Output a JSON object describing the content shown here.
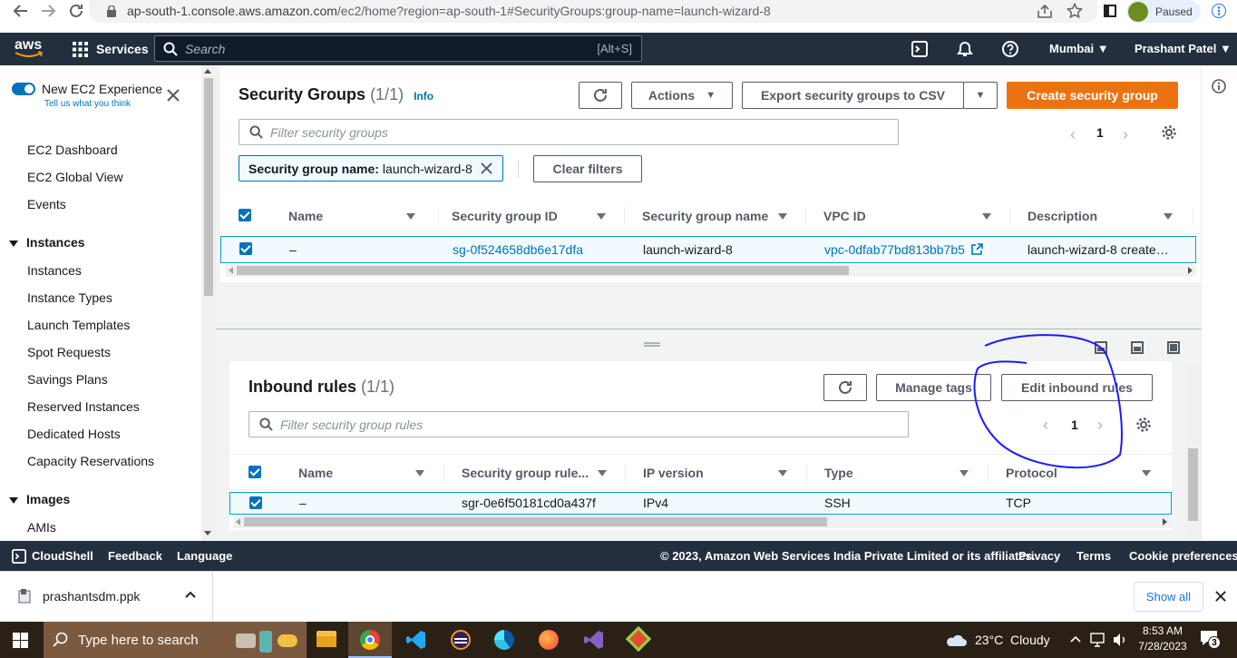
{
  "browser": {
    "url_host": "ap-south-1.console.aws.amazon.com",
    "url_path": "/ec2/home?region=ap-south-1#SecurityGroups:group-name=launch-wizard-8",
    "profile_status": "Paused"
  },
  "aws_nav": {
    "logo": "aws",
    "services_label": "Services",
    "search_placeholder": "Search",
    "search_shortcut": "[Alt+S]",
    "region": "Mumbai",
    "user": "Prashant Patel"
  },
  "sidebar": {
    "new_experience_label": "New EC2 Experience",
    "new_experience_sub": "Tell us what you think",
    "items_top": [
      "EC2 Dashboard",
      "EC2 Global View",
      "Events"
    ],
    "section_instances": "Instances",
    "instances_items": [
      "Instances",
      "Instance Types",
      "Launch Templates",
      "Spot Requests",
      "Savings Plans",
      "Reserved Instances",
      "Dedicated Hosts",
      "Capacity Reservations"
    ],
    "section_images": "Images",
    "images_items": [
      "AMIs"
    ]
  },
  "security_groups": {
    "title": "Security Groups",
    "count": "(1/1)",
    "info": "Info",
    "actions_label": "Actions",
    "export_label": "Export security groups to CSV",
    "create_label": "Create security group",
    "filter_placeholder": "Filter security groups",
    "page": "1",
    "token_key": "Security group name:",
    "token_value": "launch-wizard-8",
    "clear_filters": "Clear filters",
    "columns": [
      "Name",
      "Security group ID",
      "Security group name",
      "VPC ID",
      "Description"
    ],
    "row": {
      "name": "–",
      "sg_id": "sg-0f524658db6e17dfa",
      "sg_name": "launch-wizard-8",
      "vpc_id": "vpc-0dfab77bd813bb7b5",
      "description": "launch-wizard-8 create…"
    }
  },
  "inbound_rules": {
    "title": "Inbound rules",
    "count": "(1/1)",
    "manage_tags": "Manage tags",
    "edit_rules": "Edit inbound rules",
    "filter_placeholder": "Filter security group rules",
    "page": "1",
    "columns": [
      "Name",
      "Security group rule...",
      "IP version",
      "Type",
      "Protocol"
    ],
    "row": {
      "name": "–",
      "rule_id": "sgr-0e6f50181cd0a437f",
      "ip_version": "IPv4",
      "type": "SSH",
      "protocol": "TCP"
    }
  },
  "footer": {
    "cloudshell": "CloudShell",
    "feedback": "Feedback",
    "language": "Language",
    "copyright": "© 2023, Amazon Web Services India Private Limited or its affiliates.",
    "privacy": "Privacy",
    "terms": "Terms",
    "cookie": "Cookie preferences"
  },
  "download": {
    "filename": "prashantsdm.ppk",
    "show_all": "Show all"
  },
  "taskbar": {
    "search_placeholder": "Type here to search",
    "weather": "23°C  Cloudy",
    "time": "8:53 AM",
    "date": "7/28/2023",
    "notif_count": "3"
  },
  "colors": {
    "aws_nav": "#232f3e",
    "primary": "#ec7211",
    "link": "#0073bb",
    "annotation": "#1a1aff"
  }
}
